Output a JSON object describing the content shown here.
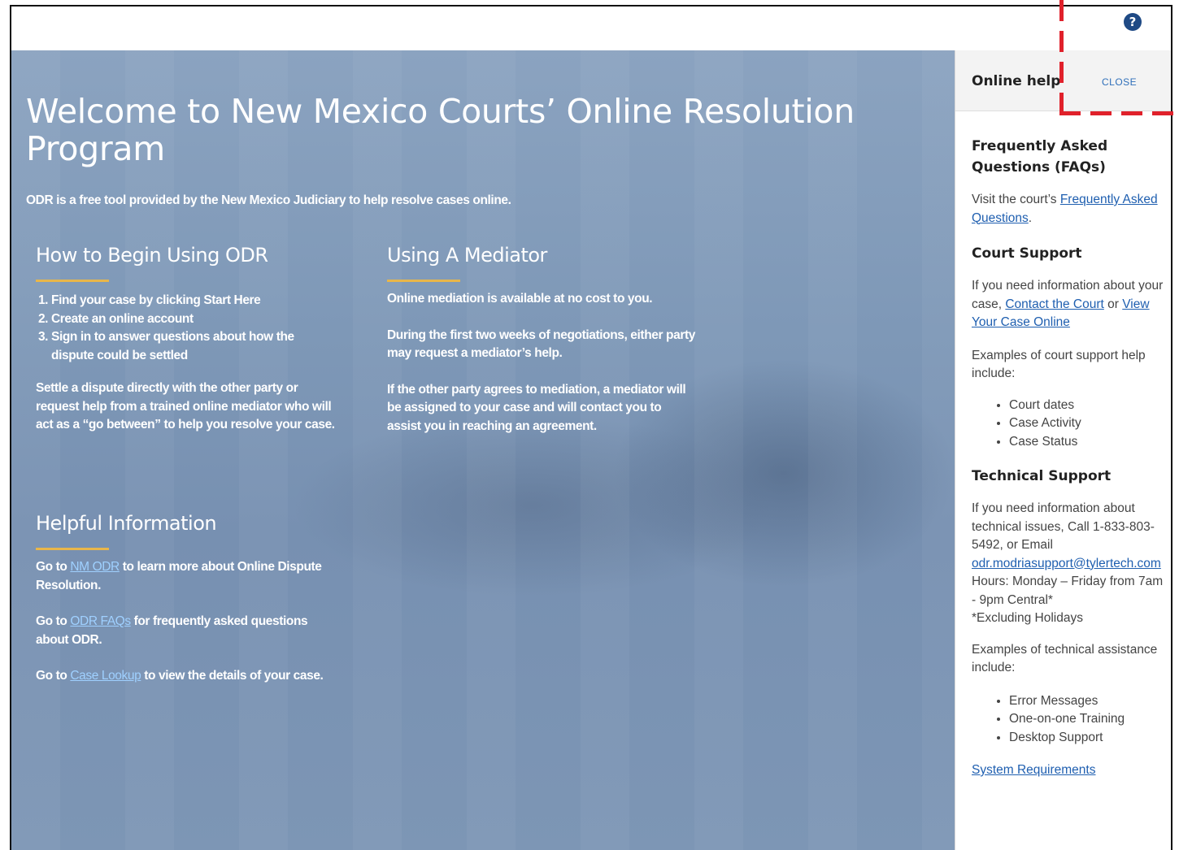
{
  "hero": {
    "title": "Welcome to New Mexico Courts’ Online Resolution Program",
    "subtitle": "ODR is a free tool provided by the New Mexico Judiciary to help resolve cases online."
  },
  "how_to_begin": {
    "title": "How to Begin Using ODR",
    "steps": [
      "Find your case by clicking Start Here",
      "Create an online account",
      "Sign in to answer questions about how the dispute could be settled"
    ],
    "description": "Settle a dispute directly with the other party or request help from a trained online mediator who will act as a “go between” to help you resolve your case."
  },
  "mediator": {
    "title": "Using A Mediator",
    "paragraphs": [
      "Online mediation is available at no cost to you.",
      "During the first two weeks of negotiations, either party may request a mediator’s help.",
      "If the other party agrees to mediation, a mediator will be assigned to your case and will contact you to assist you in reaching an agreement."
    ]
  },
  "helpful": {
    "title": "Helpful Information",
    "items": [
      {
        "prefix": "Go to ",
        "link": "NM ODR",
        "suffix": " to learn more about Online Dispute Resolution."
      },
      {
        "prefix": "Go to ",
        "link": "ODR FAQs",
        "suffix": " for frequently asked questions about ODR."
      },
      {
        "prefix": "Go to ",
        "link": "Case Lookup",
        "suffix": " to view the details of your case."
      }
    ]
  },
  "panel": {
    "title": "Online help",
    "close_label": "CLOSE",
    "faq": {
      "title": "Frequently Asked Questions (FAQs)",
      "text_prefix": "Visit the court’s ",
      "link": "Frequently Asked Questions",
      "text_suffix": "."
    },
    "court_support": {
      "title": "Court Support",
      "text_prefix": "If you need information about your case, ",
      "link1": "Contact the Court",
      "text_mid": " or ",
      "link2": "View Your Case Online",
      "examples_label": "Examples of court support help include:",
      "examples": [
        "Court dates",
        "Case Activity",
        "Case Status"
      ]
    },
    "technical_support": {
      "title": "Technical Support",
      "text": "If you need information about technical issues, Call 1-833-803-5492, or Email",
      "email": "odr.modriasupport@tylertech.com",
      "hours": "Hours: Monday – Friday from 7am - 9pm Central*",
      "holidays": "*Excluding Holidays",
      "examples_label": "Examples of technical assistance include:",
      "examples": [
        "Error Messages",
        "One-on-one Training",
        "Desktop Support"
      ]
    },
    "system_requirements": "System Requirements"
  },
  "colors": {
    "accent": "#e8b64a",
    "hero_link": "#9fd0ff",
    "panel_link": "#1f5fb0",
    "help_icon": "#1f4a85",
    "annotation": "#e0212b"
  }
}
